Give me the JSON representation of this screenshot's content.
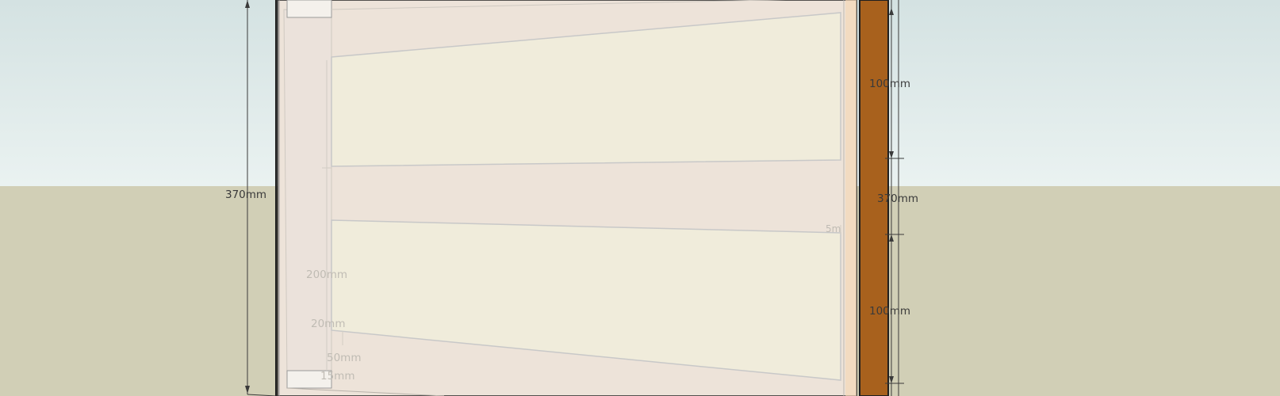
{
  "scene": {
    "colors": {
      "sky_top": "#d4e2e2",
      "sky_bottom": "#eaf2f1",
      "ground": "#d1cfb6",
      "board": "#ede3d9",
      "panel": "#f0ecdb",
      "wood_post": "#a8611d",
      "outline": "#1f1f1f",
      "faded_edge": "#c8c8c8"
    }
  },
  "dimensions": {
    "left_height": "370mm",
    "right_height": "370mm",
    "right_top_segment": "100mm",
    "right_bottom_segment": "100mm",
    "inner_200": "200mm",
    "inner_20": "20mm",
    "inner_50": "50mm",
    "inner_15": "15mm",
    "inner_small": "5m"
  }
}
